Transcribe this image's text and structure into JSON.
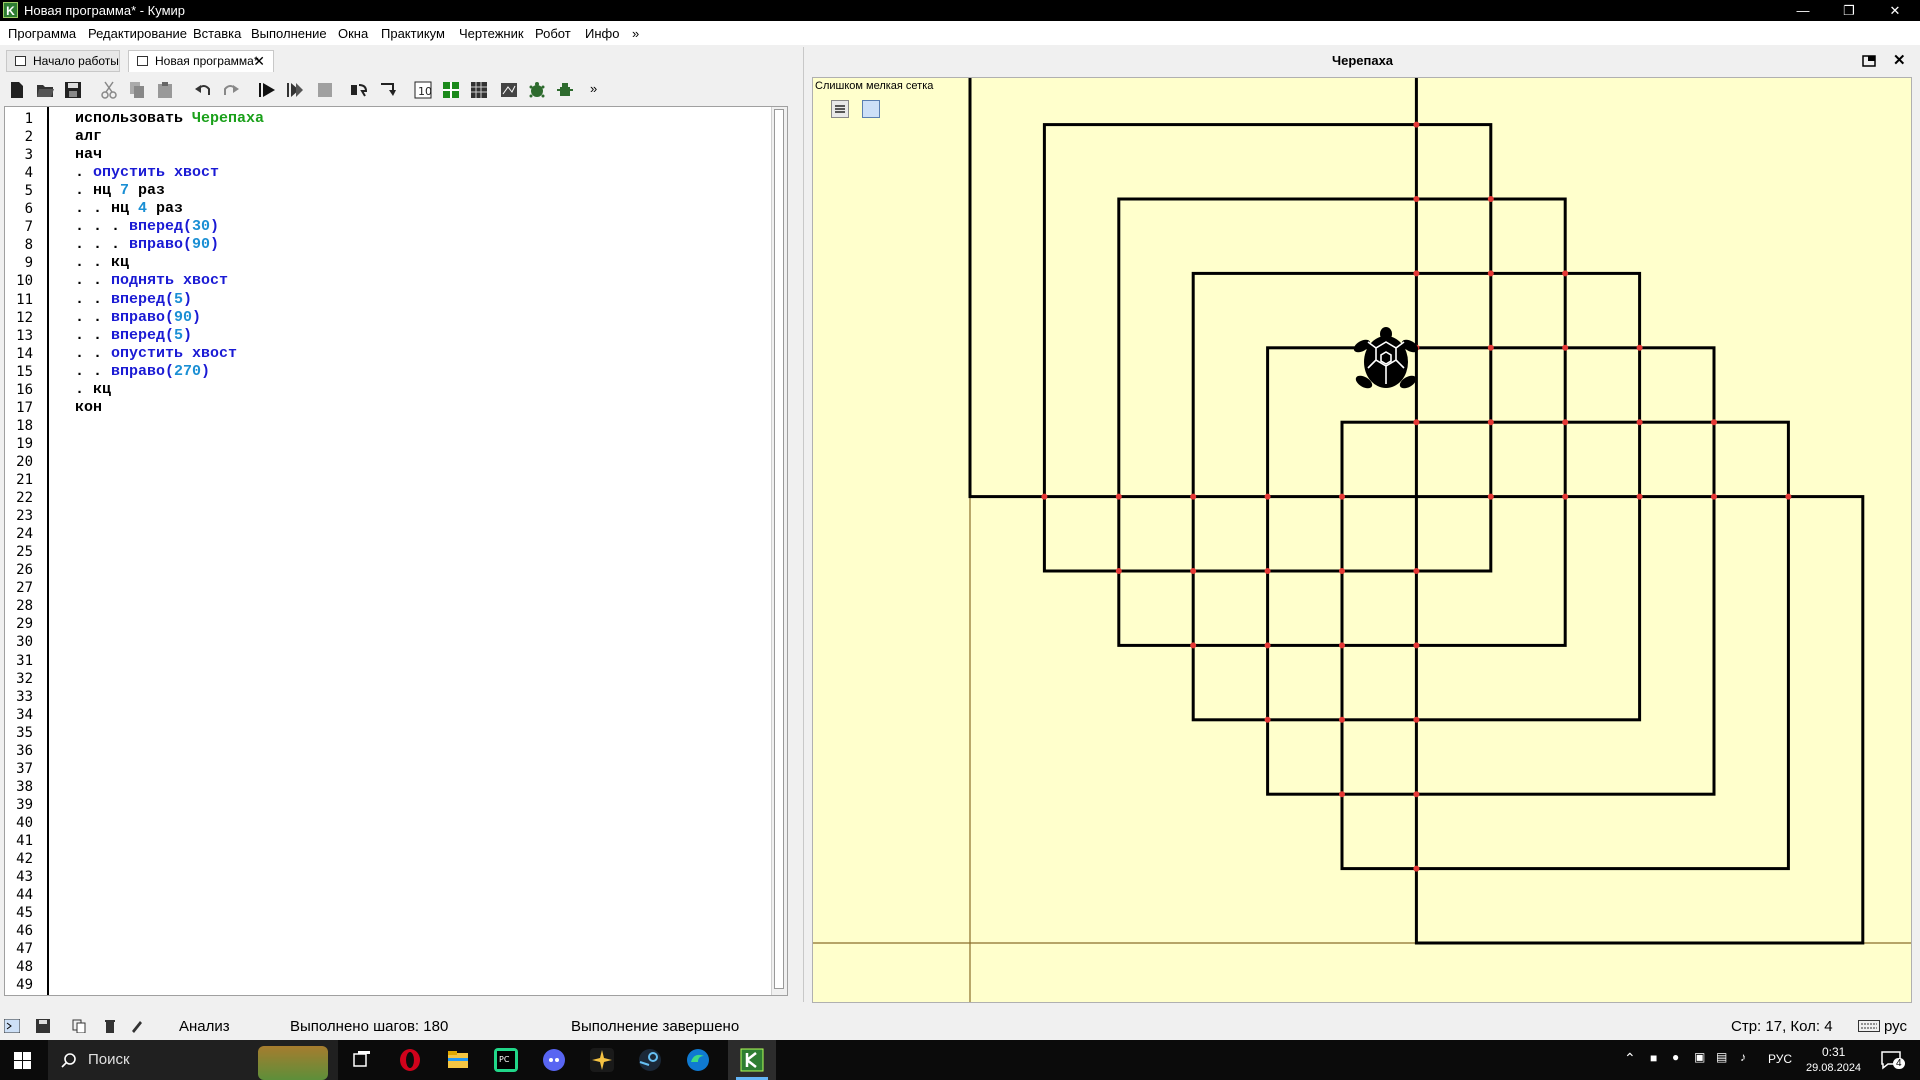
{
  "window": {
    "title": "Новая программа* - Кумир",
    "app_icon": "K",
    "controls": [
      "minimize-icon",
      "restore-icon",
      "close-icon"
    ]
  },
  "menu": [
    "Программа",
    "Редактирование",
    "Вставка",
    "Выполнение",
    "Окна",
    "Практикум",
    "Чертежник",
    "Робот",
    "Инфо",
    "»"
  ],
  "tabs": [
    {
      "label": "Начало работы",
      "active": false
    },
    {
      "label": "Новая программа*",
      "active": true
    }
  ],
  "toolbar": {
    "icons": [
      "new-file-icon",
      "open-file-icon",
      "save-icon",
      "cut-icon",
      "copy-icon",
      "paste-icon",
      "undo-icon",
      "redo-icon",
      "run-icon",
      "step-run-icon",
      "stop-icon",
      "step-over-icon",
      "step-into-icon",
      "variables-icon",
      "robot-field-icon",
      "table-icon",
      "drawer-icon",
      "turtle-icon",
      "robot-icon"
    ],
    "more": "»"
  },
  "editor": {
    "line_numbers": [
      "1",
      "2",
      "3",
      "4",
      "5",
      "6",
      "7",
      "8",
      "9",
      "10",
      "11",
      "12",
      "13",
      "14",
      "15",
      "16",
      "17",
      "18",
      "19",
      "20",
      "21",
      "22",
      "23",
      "24",
      "25",
      "26",
      "27",
      "28",
      "29",
      "30",
      "31",
      "32",
      "33",
      "34",
      "35",
      "36",
      "37",
      "38",
      "39",
      "40",
      "41",
      "42",
      "43",
      "44",
      "45",
      "46",
      "47",
      "48",
      "49"
    ],
    "lines": [
      [
        {
          "t": "использовать ",
          "c": "kw"
        },
        {
          "t": "Черепаха",
          "c": "mod"
        }
      ],
      [
        {
          "t": "алг",
          "c": "kw"
        }
      ],
      [
        {
          "t": "нач",
          "c": "kw"
        }
      ],
      [
        {
          "t": ". ",
          "c": "kw"
        },
        {
          "t": "опустить хвост",
          "c": "fn"
        }
      ],
      [
        {
          "t": ". нц ",
          "c": "kw"
        },
        {
          "t": "7",
          "c": "num"
        },
        {
          "t": " раз",
          "c": "kw"
        }
      ],
      [
        {
          "t": ". . нц ",
          "c": "kw"
        },
        {
          "t": "4",
          "c": "num"
        },
        {
          "t": " раз",
          "c": "kw"
        }
      ],
      [
        {
          "t": ". . . ",
          "c": "kw"
        },
        {
          "t": "вперед(",
          "c": "fn"
        },
        {
          "t": "30",
          "c": "num"
        },
        {
          "t": ")",
          "c": "fn"
        }
      ],
      [
        {
          "t": ". . . ",
          "c": "kw"
        },
        {
          "t": "вправо(",
          "c": "fn"
        },
        {
          "t": "90",
          "c": "num"
        },
        {
          "t": ")",
          "c": "fn"
        }
      ],
      [
        {
          "t": ". . кц",
          "c": "kw"
        }
      ],
      [
        {
          "t": ". . ",
          "c": "kw"
        },
        {
          "t": "поднять хвост",
          "c": "fn"
        }
      ],
      [
        {
          "t": ". . ",
          "c": "kw"
        },
        {
          "t": "вперед(",
          "c": "fn"
        },
        {
          "t": "5",
          "c": "num"
        },
        {
          "t": ")",
          "c": "fn"
        }
      ],
      [
        {
          "t": ". . ",
          "c": "kw"
        },
        {
          "t": "вправо(",
          "c": "fn"
        },
        {
          "t": "90",
          "c": "num"
        },
        {
          "t": ")",
          "c": "fn"
        }
      ],
      [
        {
          "t": ". . ",
          "c": "kw"
        },
        {
          "t": "вперед(",
          "c": "fn"
        },
        {
          "t": "5",
          "c": "num"
        },
        {
          "t": ")",
          "c": "fn"
        }
      ],
      [
        {
          "t": ". . ",
          "c": "kw"
        },
        {
          "t": "опустить хвост",
          "c": "fn"
        }
      ],
      [
        {
          "t": ". . ",
          "c": "kw"
        },
        {
          "t": "вправо(",
          "c": "fn"
        },
        {
          "t": "270",
          "c": "num"
        },
        {
          "t": ")",
          "c": "fn"
        }
      ],
      [
        {
          "t": ". кц",
          "c": "kw"
        }
      ],
      [
        {
          "t": "кон",
          "c": "kw"
        }
      ]
    ]
  },
  "turtle": {
    "panel_title": "Черепаха",
    "grid_note": "Слишком мелкая сетка",
    "canvas_bg": "#ffffcc",
    "line_color": "#000000",
    "dot_color": "#e53935",
    "panel_icons": [
      "float-window-icon",
      "close-icon"
    ],
    "controls": [
      "menu-icon",
      "color-swatch-icon"
    ]
  },
  "status": {
    "mode": "Анализ",
    "steps": "Выполнено шагов: 180",
    "message": "Выполнение завершено",
    "position": "Стр: 17, Кол: 4",
    "language": "рус",
    "icons": [
      "console-icon",
      "save-console-icon",
      "copy-console-icon",
      "clear-icon",
      "edit-icon",
      "keyboard-icon"
    ]
  },
  "taskbar": {
    "search_placeholder": "Поиск",
    "apps": [
      "task-view-icon",
      "opera-icon",
      "explorer-icon",
      "pycharm-icon",
      "discord-icon",
      "app-icon",
      "steam-icon",
      "edge-icon",
      "kumir-icon"
    ],
    "lang": "РУС",
    "time": "0:31",
    "date": "29.08.2024",
    "notifications": "4"
  }
}
